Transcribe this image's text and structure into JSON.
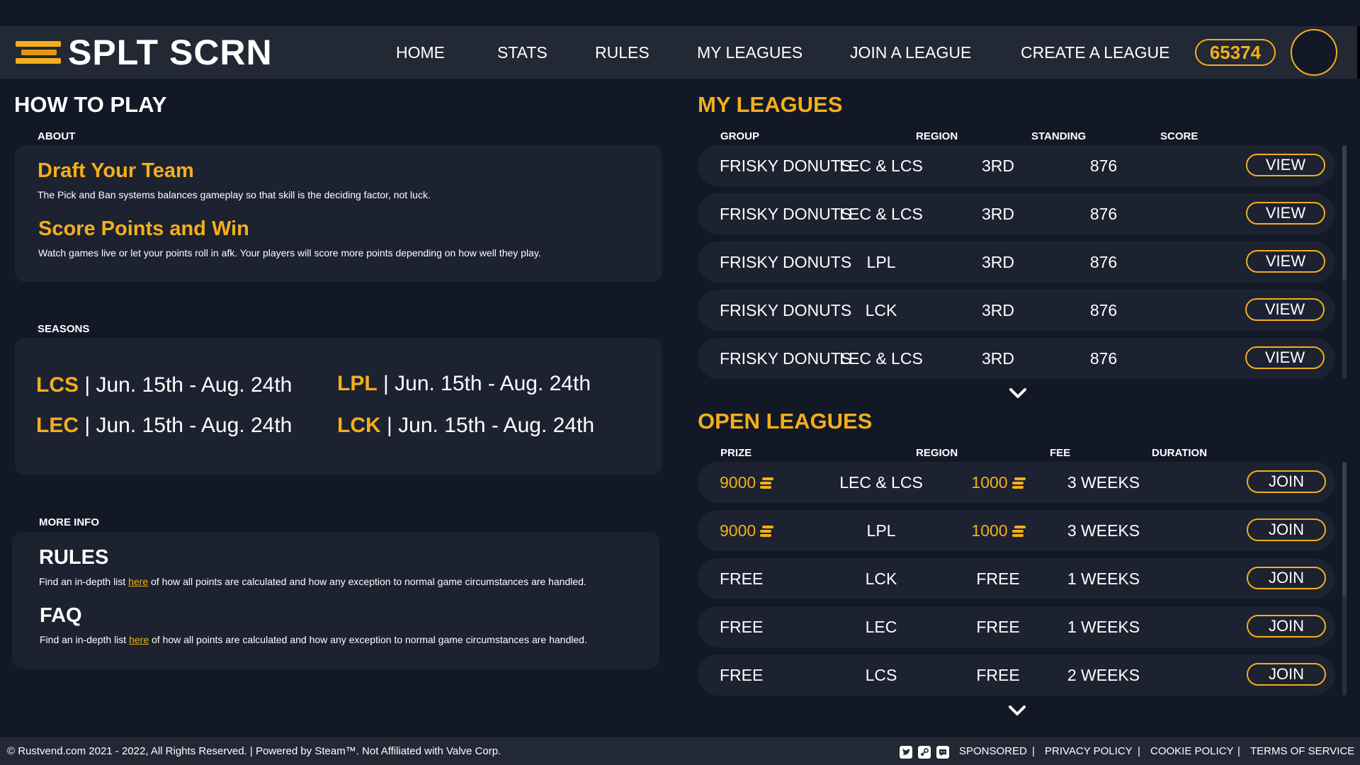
{
  "brand": {
    "name": "SPLT SCRN",
    "accent": "#f5ae1b",
    "background": "#121826",
    "panel": "#1c2230"
  },
  "nav": {
    "links": [
      "HOME",
      "STATS",
      "RULES",
      "MY LEAGUES",
      "JOIN A LEAGUE",
      "CREATE A LEAGUE"
    ],
    "balance": "65374"
  },
  "how_to_play": {
    "title": "HOW TO PLAY",
    "about_label": "ABOUT",
    "about": [
      {
        "title": "Draft Your Team",
        "text": "The Pick and Ban systems balances gameplay so that skill is the deciding factor, not luck."
      },
      {
        "title": "Score Points and Win",
        "text": "Watch games live or let your points roll in afk. Your players will score more points depending on how well they play."
      }
    ],
    "seasons_label": "SEASONS",
    "seasons": [
      {
        "code": "LCS",
        "dates": "| Jun. 15th - Aug. 24th"
      },
      {
        "code": "LPL",
        "dates": "| Jun. 15th - Aug. 24th"
      },
      {
        "code": "LEC",
        "dates": "| Jun. 15th - Aug. 24th"
      },
      {
        "code": "LCK",
        "dates": "| Jun. 15th - Aug. 24th"
      }
    ],
    "more_info_label": "MORE INFO",
    "more_info": [
      {
        "title": "RULES",
        "pre": "Find an in-depth list ",
        "link": "here",
        "post": " of how all points are calculated and how any exception to normal game circumstances are handled."
      },
      {
        "title": "FAQ",
        "pre": "Find an in-depth list ",
        "link": "here",
        "post": " of how all points are calculated and how any exception to normal game circumstances are handled."
      }
    ]
  },
  "my_leagues": {
    "title": "MY LEAGUES",
    "columns": [
      "GROUP",
      "REGION",
      "STANDING",
      "SCORE"
    ],
    "action_label": "VIEW",
    "rows": [
      {
        "group": "FRISKY DONUTS",
        "region": "LEC & LCS",
        "standing": "3RD",
        "score": "876"
      },
      {
        "group": "FRISKY DONUTS",
        "region": "LEC & LCS",
        "standing": "3RD",
        "score": "876"
      },
      {
        "group": "FRISKY DONUTS",
        "region": "LPL",
        "standing": "3RD",
        "score": "876"
      },
      {
        "group": "FRISKY DONUTS",
        "region": "LCK",
        "standing": "3RD",
        "score": "876"
      },
      {
        "group": "FRISKY DONUTS",
        "region": "LEC & LCS",
        "standing": "3RD",
        "score": "876"
      }
    ]
  },
  "open_leagues": {
    "title": "OPEN LEAGUES",
    "columns": [
      "PRIZE",
      "REGION",
      "FEE",
      "DURATION"
    ],
    "action_label": "JOIN",
    "rows": [
      {
        "prize": "9000",
        "prize_coin": true,
        "region": "LEC & LCS",
        "fee": "1000",
        "fee_coin": true,
        "duration": "3 WEEKS"
      },
      {
        "prize": "9000",
        "prize_coin": true,
        "region": "LPL",
        "fee": "1000",
        "fee_coin": true,
        "duration": "3 WEEKS"
      },
      {
        "prize": "FREE",
        "prize_coin": false,
        "region": "LCK",
        "fee": "FREE",
        "fee_coin": false,
        "duration": "1 WEEKS"
      },
      {
        "prize": "FREE",
        "prize_coin": false,
        "region": "LEC",
        "fee": "FREE",
        "fee_coin": false,
        "duration": "1 WEEKS"
      },
      {
        "prize": "FREE",
        "prize_coin": false,
        "region": "LCS",
        "fee": "FREE",
        "fee_coin": false,
        "duration": "2 WEEKS"
      }
    ]
  },
  "footer": {
    "copyright": "© Rustvend.com 2021 - 2022, All Rights Reserved. | Powered by Steam™. Not Affiliated with Valve Corp.",
    "social_icons": [
      "twitter-icon",
      "steam-icon",
      "discord-icon"
    ],
    "links": [
      "SPONSORED",
      "PRIVACY POLICY",
      "COOKIE POLICY",
      "TERMS OF SERVICE"
    ]
  }
}
